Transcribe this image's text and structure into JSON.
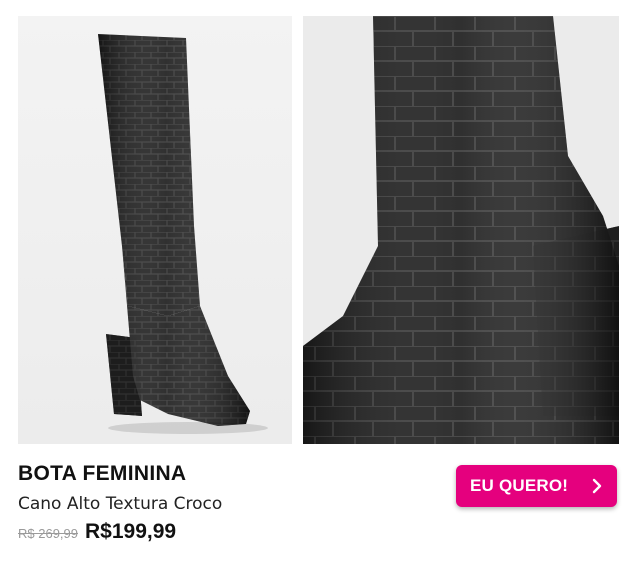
{
  "product": {
    "title": "BOTA FEMININA",
    "subtitle": "Cano Alto Textura Croco",
    "old_price": "R$ 269,99",
    "new_price": "R$199,99"
  },
  "cta": {
    "label": "EU QUERO!",
    "icon": "chevron-right-icon"
  },
  "colors": {
    "accent": "#e5007e",
    "boot": "#1c1c1c"
  }
}
